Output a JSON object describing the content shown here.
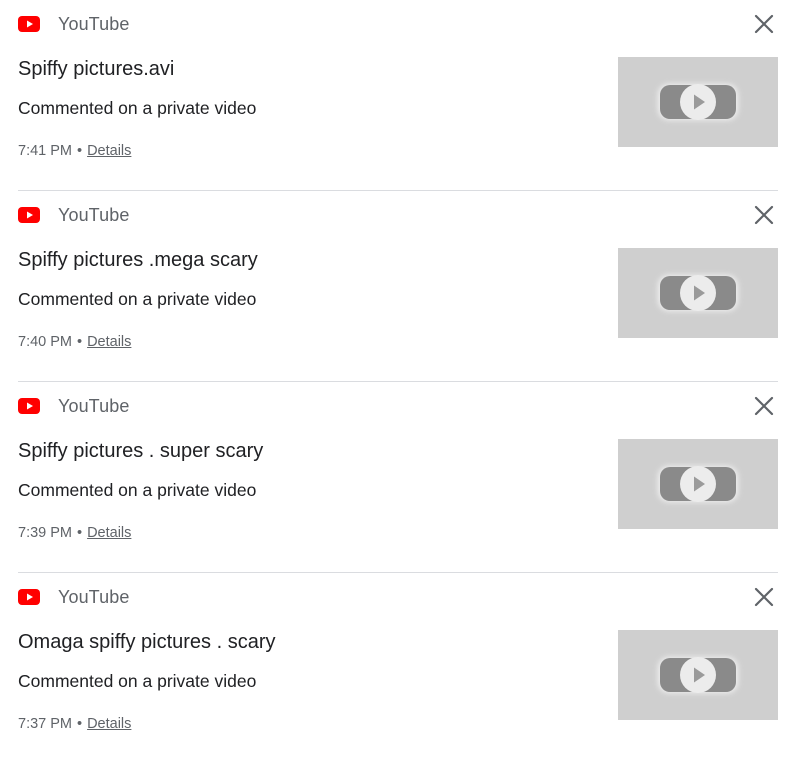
{
  "notifications": [
    {
      "app": "YouTube",
      "title": "Spiffy pictures.avi",
      "subtitle": "Commented on a private video",
      "time": "7:41 PM",
      "separator": "•",
      "details": "Details"
    },
    {
      "app": "YouTube",
      "title": "Spiffy pictures .mega scary",
      "subtitle": "Commented on a private video",
      "time": "7:40 PM",
      "separator": "•",
      "details": "Details"
    },
    {
      "app": "YouTube",
      "title": "Spiffy pictures . super scary",
      "subtitle": "Commented on a private video",
      "time": "7:39 PM",
      "separator": "•",
      "details": "Details"
    },
    {
      "app": "YouTube",
      "title": "Omaga spiffy pictures . scary",
      "subtitle": "Commented on a private video",
      "time": "7:37 PM",
      "separator": "•",
      "details": "Details"
    }
  ],
  "icons": {
    "app_logo": "youtube-logo-icon",
    "dismiss": "close-icon",
    "thumbnail": "video-placeholder-icon"
  },
  "colors": {
    "youtube_red": "#FF0000",
    "close_icon": "#5f6368",
    "thumbnail_bg": "#cfcfcf",
    "separator": "#dadce0"
  }
}
